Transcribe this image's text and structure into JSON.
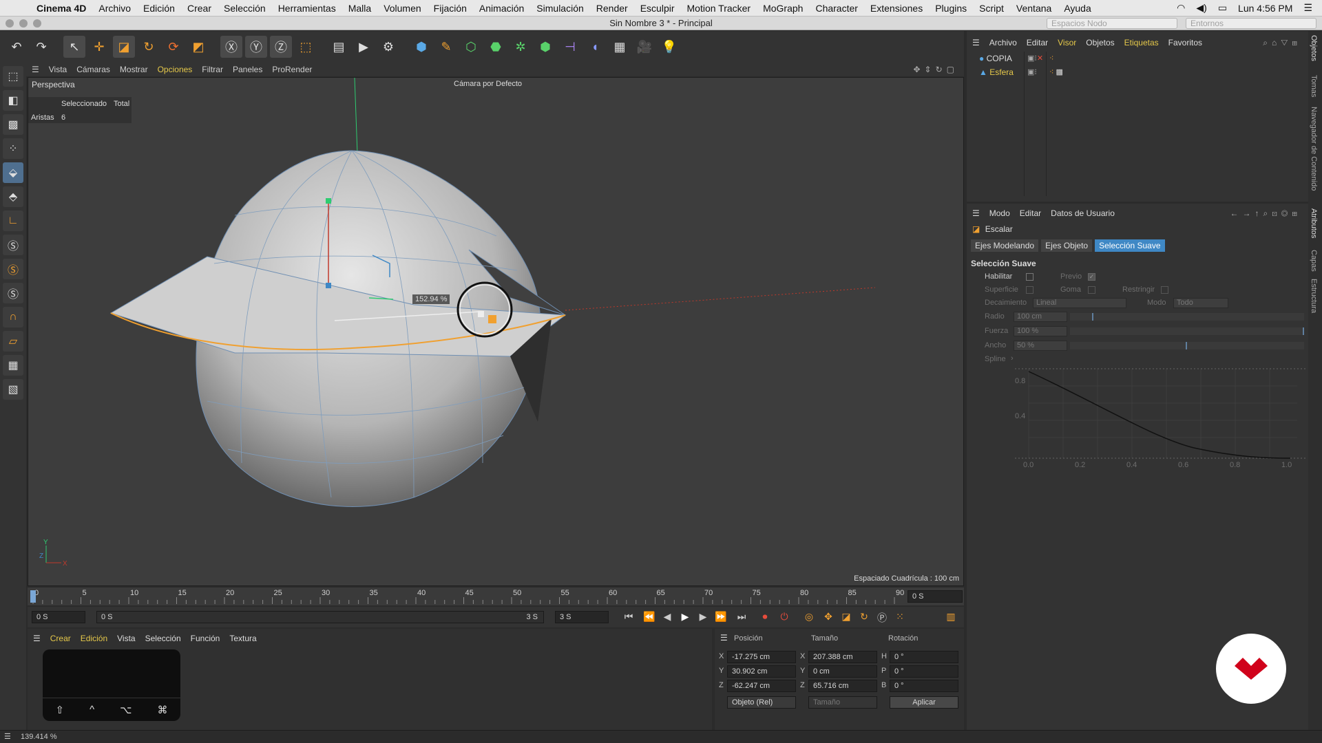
{
  "menubar": {
    "app": "Cinema 4D",
    "items": [
      "Archivo",
      "Edición",
      "Crear",
      "Selección",
      "Herramientas",
      "Malla",
      "Volumen",
      "Fijación",
      "Animación",
      "Simulación",
      "Render",
      "Esculpir",
      "Motion Tracker",
      "MoGraph",
      "Character",
      "Extensiones",
      "Plugins",
      "Script",
      "Ventana",
      "Ayuda"
    ],
    "clock": "Lun 4:56 PM"
  },
  "window": {
    "title": "Sin Nombre 3 * - Principal",
    "combo_left": "Espacios Nodo",
    "combo_right": "Entornos"
  },
  "viewport_menu": [
    "Vista",
    "Cámaras",
    "Mostrar",
    "Opciones",
    "Filtrar",
    "Paneles",
    "ProRender"
  ],
  "viewport_menu_active": "Opciones",
  "viewport": {
    "name": "Perspectiva",
    "camera": "Cámara por Defecto",
    "hud_header_sel": "Seleccionado",
    "hud_header_total": "Total",
    "hud_label": "Aristas",
    "hud_value": "6",
    "scale_readout": "152.94 %",
    "grid_spacing": "Espaciado Cuadrícula : 100 cm",
    "colors": {
      "bg": "#3d3d3d",
      "object": "#bdbdbd",
      "edge_select": "#f0a030",
      "axis_x": "#c0392b",
      "axis_y": "#2ecc71"
    }
  },
  "timeline": {
    "ticks": [
      "0",
      "5",
      "10",
      "15",
      "20",
      "25",
      "30",
      "35",
      "40",
      "45",
      "50",
      "55",
      "60",
      "65",
      "70",
      "75",
      "80",
      "85",
      "90"
    ],
    "current_frame": "0 S"
  },
  "transport": {
    "start": "0 S",
    "range_start": "0 S",
    "range_end": "3 S",
    "end": "3 S"
  },
  "material_panel": {
    "menu": [
      "Crear",
      "Edición",
      "Vista",
      "Selección",
      "Función",
      "Textura"
    ],
    "keys": [
      "⇧",
      "^",
      "⌥",
      "⌘"
    ]
  },
  "coordinates": {
    "headers": [
      "Posición",
      "Tamaño",
      "Rotación"
    ],
    "rows": [
      {
        "axis": "X",
        "pos": "-17.275 cm",
        "size_axis": "X",
        "size": "207.388 cm",
        "rot_axis": "H",
        "rot": "0 °"
      },
      {
        "axis": "Y",
        "pos": "30.902 cm",
        "size_axis": "Y",
        "size": "0 cm",
        "rot_axis": "P",
        "rot": "0 °"
      },
      {
        "axis": "Z",
        "pos": "-62.247 cm",
        "size_axis": "Z",
        "size": "65.716 cm",
        "rot_axis": "B",
        "rot": "0 °"
      }
    ],
    "mode": "Objeto (Rel)",
    "size_mode": "Tamaño",
    "apply": "Aplicar"
  },
  "objects_panel": {
    "menu": [
      "Archivo",
      "Editar",
      "Visor",
      "Objetos",
      "Etiquetas",
      "Favoritos"
    ],
    "items": [
      "COPIA",
      "Esfera"
    ]
  },
  "attributes_panel": {
    "menu": [
      "Modo",
      "Editar",
      "Datos de Usuario"
    ],
    "tool": "Escalar",
    "tabs": [
      "Ejes Modelando",
      "Ejes Objeto",
      "Selección Suave"
    ],
    "active_tab": "Selección Suave",
    "section": "Selección Suave",
    "habilitar": "Habilitar",
    "previo": "Previo",
    "superficie": "Superficie",
    "goma": "Goma",
    "restringir": "Restringir",
    "decaimiento": "Decaimiento",
    "decaimiento_val": "Lineal",
    "modo": "Modo",
    "modo_val": "Todo",
    "radio": "Radio",
    "radio_val": "100 cm",
    "fuerza": "Fuerza",
    "fuerza_val": "100 %",
    "ancho": "Ancho",
    "ancho_val": "50 %",
    "spline": "Spline",
    "spline_y": [
      "0.8",
      "0.4"
    ],
    "spline_x": [
      "0.0",
      "0.2",
      "0.4",
      "0.6",
      "0.8",
      "1.0"
    ]
  },
  "side_tabs": [
    "Objetos",
    "Tomas",
    "Navegador de Contenido",
    "Atributos",
    "Capas",
    "Estructura"
  ],
  "status": "139.414 %"
}
